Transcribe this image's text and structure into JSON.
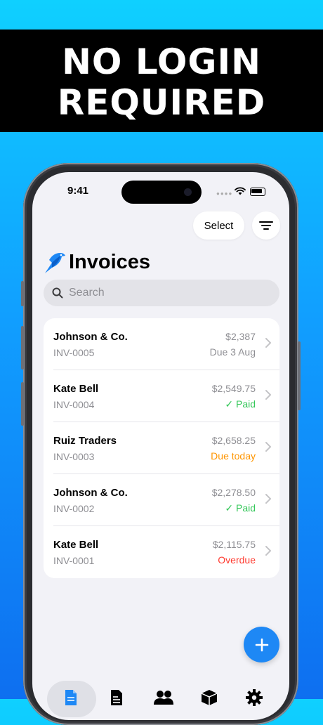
{
  "banner": {
    "line1": "NO LOGIN",
    "line2": "REQUIRED"
  },
  "status_bar": {
    "time": "9:41"
  },
  "toolbar": {
    "select_label": "Select"
  },
  "header": {
    "title": "Invoices"
  },
  "search": {
    "placeholder": "Search"
  },
  "invoices": [
    {
      "client": "Johnson & Co.",
      "number": "INV-0005",
      "amount": "$2,387",
      "status": "Due 3 Aug",
      "status_color": "#8e8e93"
    },
    {
      "client": "Kate Bell",
      "number": "INV-0004",
      "amount": "$2,549.75",
      "status": "✓ Paid",
      "status_color": "#34c759"
    },
    {
      "client": "Ruiz Traders",
      "number": "INV-0003",
      "amount": "$2,658.25",
      "status": "Due today",
      "status_color": "#ff9500"
    },
    {
      "client": "Johnson & Co.",
      "number": "INV-0002",
      "amount": "$2,278.50",
      "status": "✓ Paid",
      "status_color": "#34c759"
    },
    {
      "client": "Kate Bell",
      "number": "INV-0001",
      "amount": "$2,115.75",
      "status": "Overdue",
      "status_color": "#ff3b30"
    }
  ],
  "tabs": [
    {
      "icon": "document-icon",
      "active": true
    },
    {
      "icon": "invoice-list-icon",
      "active": false
    },
    {
      "icon": "people-icon",
      "active": false
    },
    {
      "icon": "box-icon",
      "active": false
    },
    {
      "icon": "gear-icon",
      "active": false
    }
  ],
  "colors": {
    "accent": "#1e88f5",
    "background_top": "#0fd0ff",
    "background_bottom": "#0e6ff0"
  }
}
